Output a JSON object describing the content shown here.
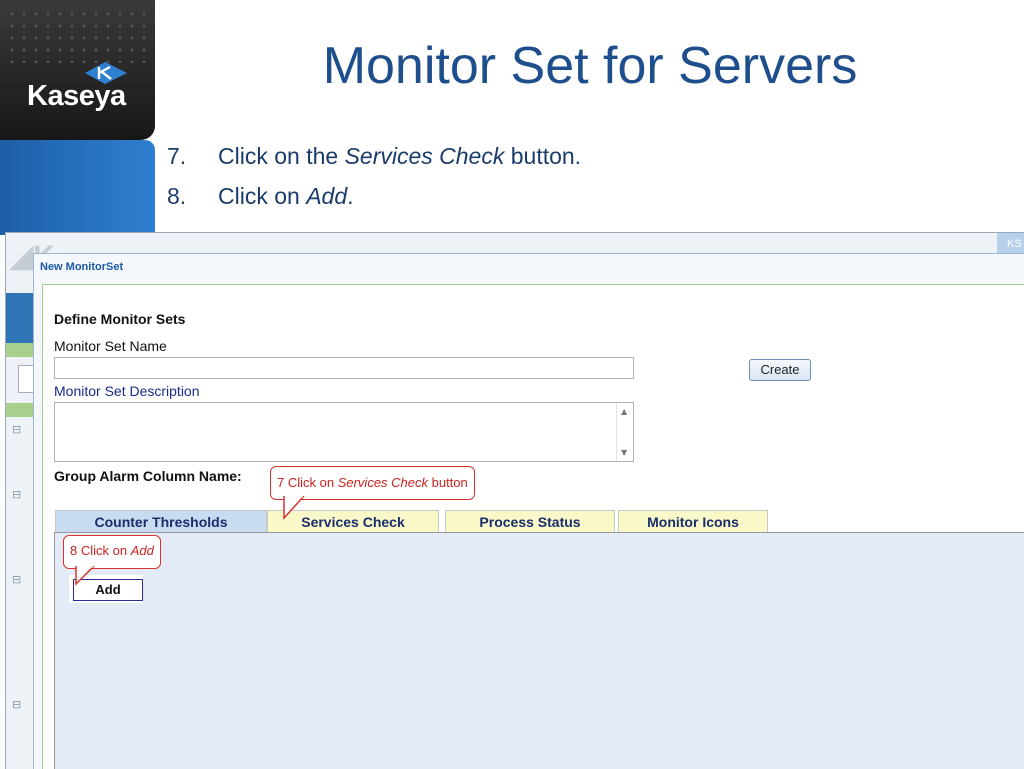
{
  "slide": {
    "logo_text": "Kaseya",
    "title": "Monitor Set for Servers",
    "steps": [
      {
        "num": "7.",
        "pre": "Click on the ",
        "em": "Services Check",
        "post": " button."
      },
      {
        "num": "8.",
        "pre": "Click on ",
        "em": "Add",
        "post": "."
      }
    ]
  },
  "app": {
    "corner_tab": "KS",
    "dialog_title": "New MonitorSet",
    "section_heading": "Define Monitor Sets",
    "name_label": "Monitor Set Name",
    "name_value": "",
    "create_button": "Create",
    "description_label": "Monitor Set Description",
    "description_value": "",
    "group_alarm_label": "Group Alarm Column Name:",
    "tabs": [
      {
        "label": "Counter Thresholds",
        "active": true
      },
      {
        "label": "Services Check",
        "active": false
      },
      {
        "label": "Process Status",
        "active": false
      },
      {
        "label": "Monitor Icons",
        "active": false
      }
    ],
    "add_button": "Add"
  },
  "callouts": {
    "step7": {
      "pre": "7 Click on ",
      "em": "Services Check",
      "post": " button"
    },
    "step8": {
      "pre": "8 Click on ",
      "em": "Add"
    }
  },
  "colors": {
    "title": "#1e4f8c",
    "callout_border": "#d9322e",
    "callout_text": "#c8231f",
    "active_tab": "#c9dbf0",
    "inactive_tab": "#f8f8c8"
  }
}
